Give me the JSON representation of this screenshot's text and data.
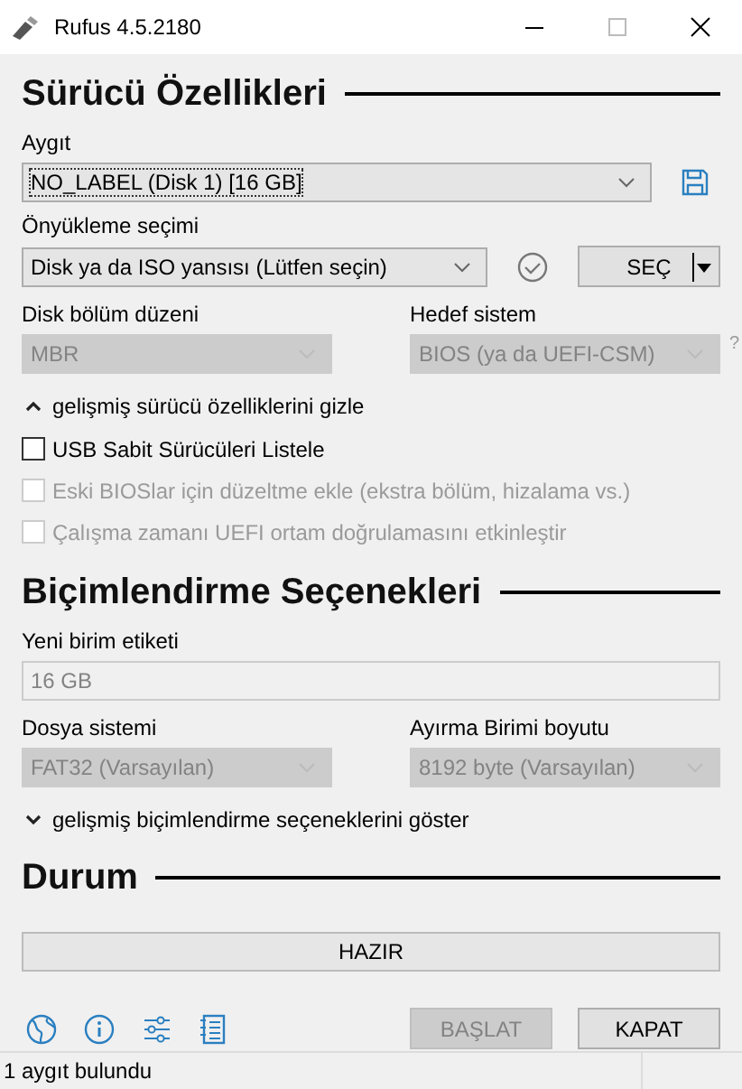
{
  "window": {
    "title": "Rufus 4.5.2180"
  },
  "drive_properties": {
    "heading": "Sürücü Özellikleri",
    "device": {
      "label": "Aygıt",
      "value": "NO_LABEL (Disk 1) [16 GB]",
      "disabled": false
    },
    "boot": {
      "label": "Önyükleme seçimi",
      "value": "Disk ya da ISO yansısı (Lütfen seçin)",
      "disabled": false,
      "button": "SEÇ"
    },
    "partition": {
      "label": "Disk bölüm düzeni",
      "value": "MBR",
      "disabled": true
    },
    "target": {
      "label": "Hedef sistem",
      "value": "BIOS (ya da UEFI-CSM)",
      "disabled": true,
      "help": "?"
    },
    "toggle": {
      "label": "gelişmiş sürücü özelliklerini gizle",
      "expanded": true
    },
    "options": [
      {
        "label": "USB Sabit Sürücüleri Listele",
        "checked": false,
        "disabled": false
      },
      {
        "label": "Eski BIOSlar için düzeltme ekle (ekstra bölüm, hizalama vs.)",
        "checked": false,
        "disabled": true
      },
      {
        "label": "Çalışma zamanı UEFI ortam doğrulamasını etkinleştir",
        "checked": false,
        "disabled": true
      }
    ]
  },
  "format_options": {
    "heading": "Biçimlendirme Seçenekleri",
    "volume_label": {
      "label": "Yeni birim etiketi",
      "value": "16 GB",
      "disabled": true
    },
    "file_system": {
      "label": "Dosya sistemi",
      "value": "FAT32 (Varsayılan)",
      "disabled": true
    },
    "cluster_size": {
      "label": "Ayırma Birimi boyutu",
      "value": "8192 byte (Varsayılan)",
      "disabled": true
    },
    "toggle": {
      "label": "gelişmiş biçimlendirme seçeneklerini göster",
      "expanded": false
    }
  },
  "status": {
    "heading": "Durum",
    "progress": {
      "text": "HAZIR"
    }
  },
  "buttons": [
    {
      "label": "BAŞLAT",
      "disabled": true
    },
    {
      "label": "KAPAT",
      "disabled": false
    }
  ],
  "status_bar": {
    "text": "1 aygıt bulundu"
  }
}
